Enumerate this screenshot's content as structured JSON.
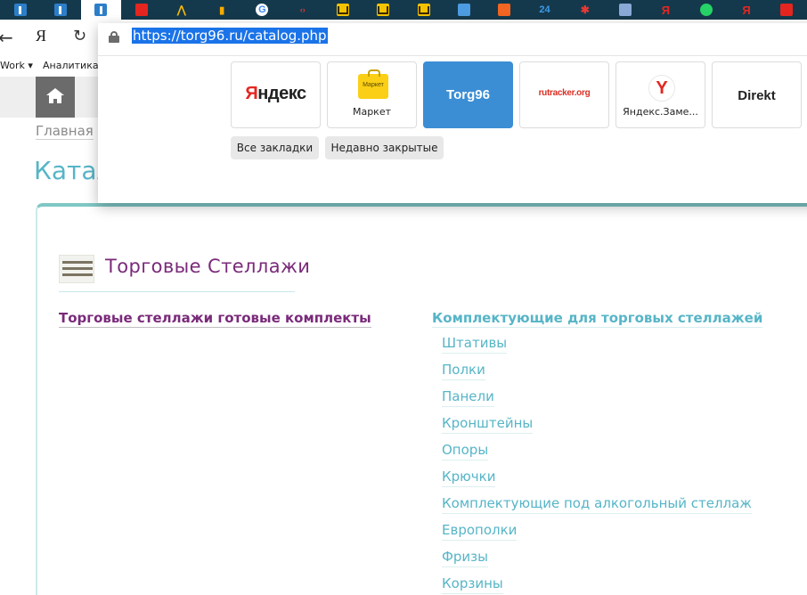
{
  "tabs": [
    {
      "icon": "sq"
    },
    {
      "icon": "sq"
    },
    {
      "icon": "sq",
      "active": true
    },
    {
      "icon": "yr"
    },
    {
      "icon": "ads",
      "glyph": "⋀"
    },
    {
      "icon": "bars",
      "glyph": "▮"
    },
    {
      "icon": "g",
      "glyph": "G"
    },
    {
      "icon": "code",
      "glyph": "‹›"
    },
    {
      "icon": "cart"
    },
    {
      "icon": "cart"
    },
    {
      "icon": "cart"
    },
    {
      "icon": "d"
    },
    {
      "icon": "p"
    },
    {
      "icon": "num",
      "glyph": "24"
    },
    {
      "icon": "flower",
      "glyph": "✱"
    },
    {
      "icon": "grid"
    },
    {
      "icon": "y",
      "glyph": "Я"
    },
    {
      "icon": "wa"
    },
    {
      "icon": "y",
      "glyph": "Я"
    },
    {
      "icon": "yr"
    }
  ],
  "toolbar": {
    "yandex_button_label": "Я"
  },
  "bookmarks_bar": {
    "work_label": "Work",
    "analytics_label": "Аналитика"
  },
  "address_dropdown": {
    "url": "https://torg96.ru/catalog.php",
    "tiles": [
      {
        "label": "Яндекс"
      },
      {
        "label": "Маркет",
        "badge": "Маркет"
      },
      {
        "label": "Torg96"
      },
      {
        "label": "rutracker.org"
      },
      {
        "label": "Яндекс.Заме..."
      },
      {
        "label": "Direkt"
      }
    ],
    "all_bookmarks_label": "Все закладки",
    "recently_closed_label": "Недавно закрытые"
  },
  "page": {
    "breadcrumb_home": "Главная",
    "title_partial": "Катал",
    "category": {
      "title": "Торговые Стеллажи",
      "left_link": "Торговые стеллажи готовые комплекты",
      "right_link": "Комплектующие для торговых стеллажей",
      "sublinks": [
        "Штативы",
        "Полки",
        "Панели",
        "Кронштейны",
        "Опоры",
        "Крючки",
        "Комплектующие под алкогольный стеллаж",
        "Европолки",
        "Фризы",
        "Корзины"
      ]
    }
  },
  "colors": {
    "accent_teal": "#56b5c7",
    "accent_purple": "#7a2a7a",
    "url_highlight": "#1a73e8",
    "torg_tile": "#3b8ed4"
  }
}
